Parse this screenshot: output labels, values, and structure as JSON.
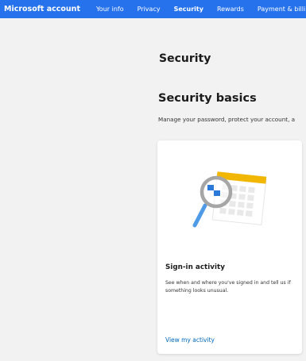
{
  "header": {
    "brand": "Microsoft account",
    "nav": [
      "Your info",
      "Privacy",
      "Security",
      "Rewards",
      "Payment & billi"
    ],
    "active": "Security"
  },
  "page": {
    "title": "Security",
    "section_title": "Security basics",
    "section_desc": "Manage your password, protect your account, a"
  },
  "card": {
    "title": "Sign-in activity",
    "description": "See when and where you've signed in and tell us if something looks unusual.",
    "link": "View my activity"
  },
  "colors": {
    "topbar": "#2672ec",
    "link": "#0067b8",
    "background": "#f2f2f2"
  }
}
